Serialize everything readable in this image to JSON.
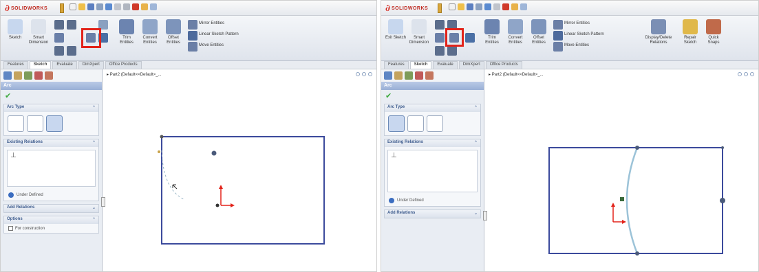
{
  "app_name": "SOLIDWORKS",
  "left_panel": {
    "ribbon": {
      "sketch": "Sketch",
      "smart_dimension": "Smart Dimension",
      "trim": "Trim Entities",
      "convert": "Convert Entities",
      "offset": "Offset Entities",
      "mirror": "Mirror Entities",
      "linear_pattern": "Linear Sketch Pattern",
      "move": "Move Entities"
    },
    "tabs": [
      "Features",
      "Sketch",
      "Evaluate",
      "DimXpert",
      "Office Products"
    ],
    "active_tab": "Sketch",
    "pm_title": "Arc",
    "groups": {
      "arc_type": "Arc Type",
      "existing_relations": "Existing Relations",
      "add_relations": "Add Relations",
      "options": "Options"
    },
    "status": "Under Defined",
    "option_check": "For construction",
    "tree_label": "Part2 (Default<<Default>_..."
  },
  "right_panel": {
    "ribbon": {
      "exit_sketch": "Exit Sketch",
      "smart_dimension": "Smart Dimension",
      "trim": "Trim Entities",
      "convert": "Convert Entities",
      "offset": "Offset Entities",
      "mirror": "Mirror Entities",
      "linear_pattern": "Linear Sketch Pattern",
      "move": "Move Entities",
      "display_delete": "Display/Delete Relations",
      "repair": "Repair Sketch",
      "quick": "Quick Snaps"
    },
    "tabs": [
      "Features",
      "Sketch",
      "Evaluate",
      "DimXpert",
      "Office Products"
    ],
    "active_tab": "Sketch",
    "pm_title": "Arc",
    "groups": {
      "arc_type": "Arc Type",
      "existing_relations": "Existing Relations",
      "add_relations": "Add Relations"
    },
    "status": "Under Defined",
    "tree_label": "Part2 (Default<<Default>_..."
  },
  "colors": {
    "highlight": "#e2231a",
    "sketch_line": "#3b4a9c",
    "arc": "#9cc3d8",
    "origin": "#e2231a"
  },
  "icons": [
    "sketch-icon",
    "smart-dimension-icon",
    "arc-icon",
    "trim-icon",
    "convert-icon",
    "offset-icon",
    "mirror-icon",
    "pattern-icon",
    "move-icon",
    "checkmark-icon",
    "centerpoint-arc-icon",
    "tangent-arc-icon",
    "3point-arc-icon",
    "perpendicular-icon"
  ]
}
